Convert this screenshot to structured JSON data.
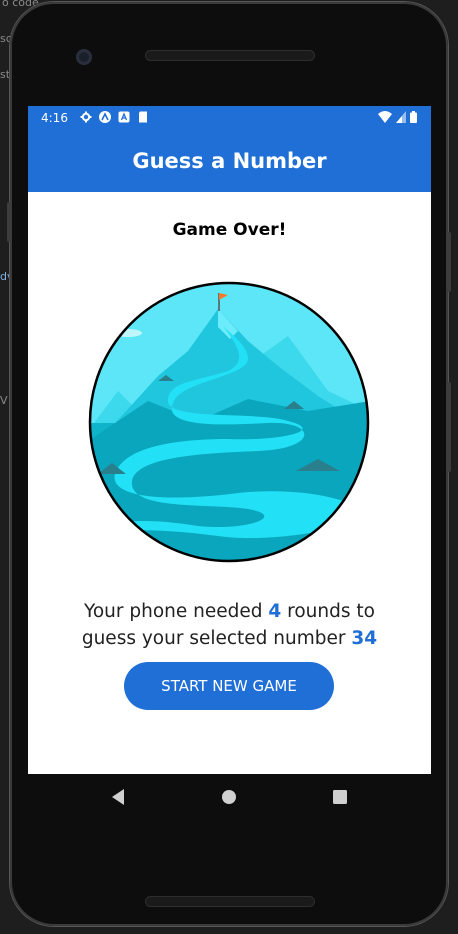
{
  "status_bar": {
    "time": "4:16"
  },
  "app_bar": {
    "title": "Guess a Number"
  },
  "screen": {
    "heading": "Game Over!",
    "result": {
      "prefix": "Your phone needed ",
      "rounds": "4",
      "middle": " rounds to",
      "line2_prefix": "guess your selected number ",
      "number": "34"
    },
    "button_label": "START NEW GAME"
  },
  "background_text": {
    "top_left": "o code",
    "left_1": "sc",
    "left_2": "st",
    "left_3": "dv",
    "left_4": "V"
  },
  "colors": {
    "primary": "#1f6fd6",
    "sky": "#5ce6f7",
    "river": "#22e0f5",
    "mountain": "#1fc6dd",
    "flag": "#f47a2a"
  }
}
